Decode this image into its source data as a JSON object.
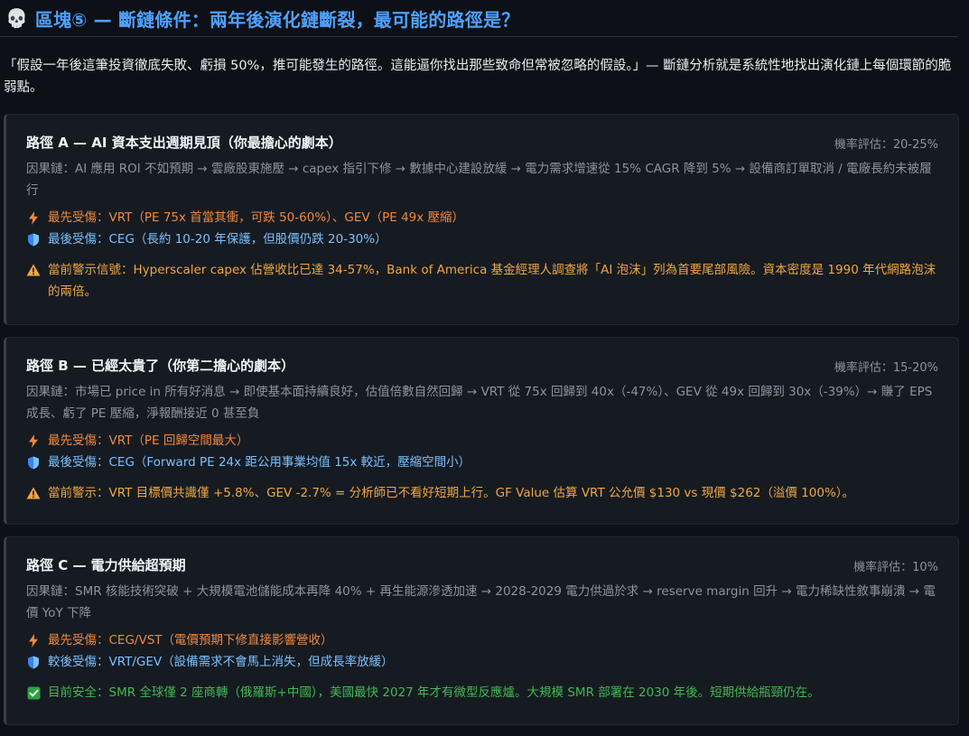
{
  "header": {
    "icon": "skull-icon",
    "title": "區塊⑤ — 斷鏈條件：兩年後演化鏈斷裂，最可能的路徑是？"
  },
  "intro": "「假設一年後這筆投資徹底失敗、虧損 50%，推可能發生的路徑。這能逼你找出那些致命但常被忽略的假設。」— 斷鏈分析就是系統性地找出演化鏈上每個環節的脆弱點。",
  "colors": {
    "accent": "#4ea1ff",
    "warning": "#f0a640",
    "safe": "#3fb950",
    "first_hit": "#f0883e",
    "last_hit": "#79c0ff"
  },
  "paths": [
    {
      "title": "路徑 A — AI 資本支出週期見頂（你最擔心的劇本）",
      "probability": "機率評估：20-25%",
      "chain": "因果鏈：AI 應用 ROI 不如預期 → 雲廠股東施壓 → capex 指引下修 → 數據中心建設放緩 → 電力需求增速從 15% CAGR 降到 5% → 設備商訂單取消 / 電廠長約未被履行",
      "first": "最先受傷：VRT（PE 75x 首當其衝，可跌 50-60%）、GEV（PE 49x 壓縮）",
      "last": "最後受傷：CEG（長約 10-20 年保護，但股價仍跌 20-30%）",
      "note": "當前警示信號：Hyperscaler capex 佔營收比已達 34-57%，Bank of America 基金經理人調查將「AI 泡沫」列為首要尾部風險。資本密度是 1990 年代網路泡沫的兩倍。"
    },
    {
      "title": "路徑 B — 已經太貴了（你第二擔心的劇本）",
      "probability": "機率評估：15-20%",
      "chain": "因果鏈：市場已 price in 所有好消息 → 即使基本面持續良好，估值倍數自然回歸 → VRT 從 75x 回歸到 40x（-47%）、GEV 從 49x 回歸到 30x（-39%）→ 賺了 EPS 成長、虧了 PE 壓縮，淨報酬接近 0 甚至負",
      "first": "最先受傷：VRT（PE 回歸空間最大）",
      "last": "最後受傷：CEG（Forward PE 24x 距公用事業均值 15x 較近，壓縮空間小）",
      "note": "當前警示：VRT 目標價共識僅 +5.8%、GEV -2.7% = 分析師已不看好短期上行。GF Value 估算 VRT 公允價 $130 vs 現價 $262（溢價 100%）。"
    },
    {
      "title": "路徑 C — 電力供給超預期",
      "probability": "機率評估：10%",
      "chain": "因果鏈：SMR 核能技術突破 + 大規模電池儲能成本再降 40% + 再生能源滲透加速 → 2028-2029 電力供過於求 → reserve margin 回升 → 電力稀缺性敘事崩潰 → 電價 YoY 下降",
      "first": "最先受傷：CEG/VST（電價預期下修直接影響營收）",
      "last": "較後受傷：VRT/GEV（設備需求不會馬上消失，但成長率放緩）",
      "note": "目前安全：SMR 全球僅 2 座商轉（俄羅斯+中國），美國最快 2027 年才有微型反應爐。大規模 SMR 部署在 2030 年後。短期供給瓶頸仍在。"
    }
  ]
}
